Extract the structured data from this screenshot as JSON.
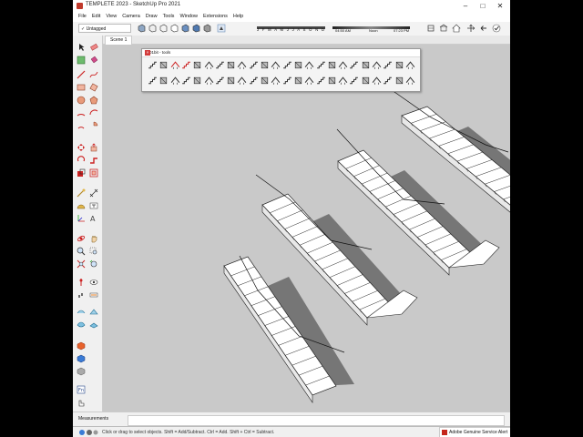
{
  "window": {
    "title": "TEMPLETE 2023 - SketchUp Pro 2021",
    "minimize": "–",
    "maximize": "□",
    "close": "✕"
  },
  "menu": [
    "File",
    "Edit",
    "View",
    "Camera",
    "Draw",
    "Tools",
    "Window",
    "Extensions",
    "Help"
  ],
  "toolbar": {
    "tag_value": "Untagged",
    "months": "J F M A M J J A S O N D",
    "time_start": "04:50 AM",
    "time_mid": "Noon",
    "time_end": "07:23 PM"
  },
  "scene_tab": "Scene 1",
  "float_toolbar": {
    "title": "1001bit - tools"
  },
  "measurements_label": "Measurements",
  "status_text": "Click or drag to select objects. Shift = Add/Subtract. Ctrl = Add. Shift + Ctrl = Subtract.",
  "notification": "Adobe Genuine Service Alert",
  "colors": {
    "viewport": "#c9c9c9",
    "stair_face": "#ffffff",
    "shadow": "#555555",
    "accent_red": "#d23b3b"
  }
}
